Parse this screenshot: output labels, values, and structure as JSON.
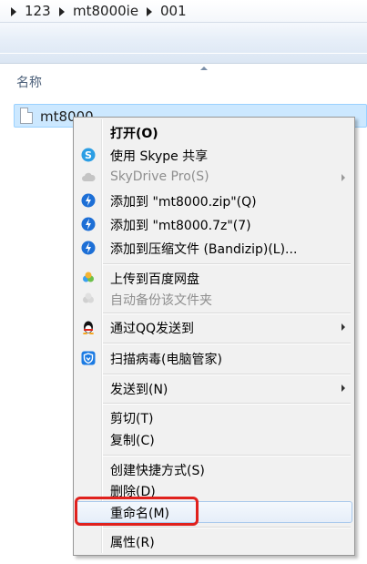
{
  "breadcrumb": [
    "123",
    "mt8000ie",
    "001"
  ],
  "column_header": {
    "name": "名称"
  },
  "file": {
    "name": "mt8000"
  },
  "menu": {
    "open": "打开(O)",
    "skype_share": "使用 Skype 共享",
    "skydrive": "SkyDrive Pro(S)",
    "add_zip": "添加到 \"mt8000.zip\"(Q)",
    "add_7z": "添加到 \"mt8000.7z\"(7)",
    "add_archive": "添加到压缩文件 (Bandizip)(L)...",
    "upload_baidu": "上传到百度网盘",
    "auto_backup": "自动备份该文件夹",
    "send_qq": "通过QQ发送到",
    "scan_virus": "扫描病毒(电脑管家)",
    "send_to": "发送到(N)",
    "cut": "剪切(T)",
    "copy": "复制(C)",
    "create_shortcut": "创建快捷方式(S)",
    "delete": "删除(D)",
    "rename": "重命名(M)",
    "properties": "属性(R)"
  },
  "colors": {
    "highlight_box": "#e0211d",
    "selection": "#cce8ff",
    "skype": "#2b9ee4",
    "bandizip": "#1d6fd6"
  }
}
